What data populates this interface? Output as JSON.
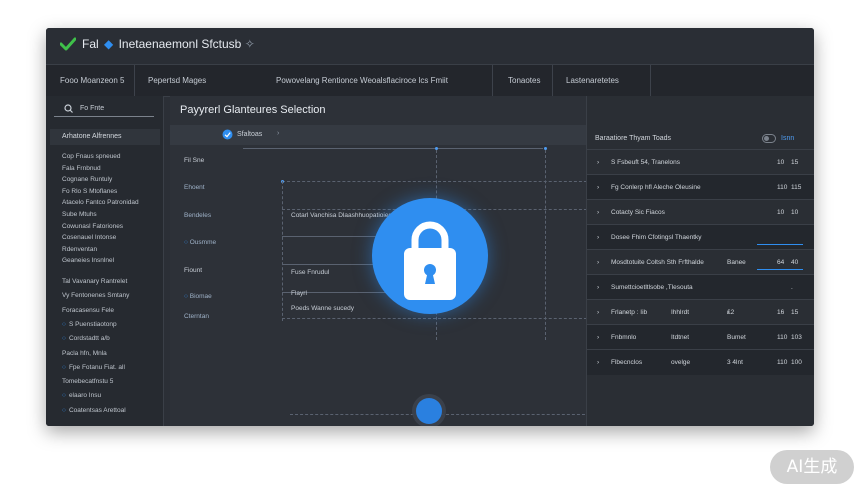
{
  "app": {
    "title_prefix": "Fal",
    "title_main": "Inetaenaemonl Sfctusb",
    "title_suffix": "✧"
  },
  "navbar": {
    "items": [
      "Fooo Moanzeon 5",
      "Pepertsd Mages",
      "Powovelang Rentionce Weoalsflaciroce lcs Fmiit",
      "Tonaotes",
      "Lastenaretetes"
    ]
  },
  "sidebar": {
    "search_text": "Fo Fnte",
    "header": "Arhatone Alfrennes",
    "group1": [
      "Cop Fnaus spneued",
      "Fala Frnbnud",
      "Cognane Runtuly",
      "Fo Rlo S Mtoflanes",
      "Atacelo Fantco Patronidad",
      "Sube Mtuhs",
      "Cowunasl Fatoriones",
      "Cosenauel Intonse",
      "Rdenventan",
      "Geaneies Insnlnel"
    ],
    "group2": [
      "Tal Vavanary Rantrelet",
      "Vy Fentonenes Smtany",
      "Foracasensu Fele",
      "S Puenstiaotonp",
      "Cordstadtt a/b",
      "Pacla hfn, Mnla",
      "Fpe Fotanu Fiat. all",
      "Tomebecatfnstu 5",
      "elaaro Insu",
      "Coatentsas Arettoal"
    ],
    "group2_dots": [
      false,
      false,
      false,
      true,
      true,
      false,
      true,
      false,
      true,
      true
    ]
  },
  "main": {
    "page_title": "Payyrerl Glanteures Selection",
    "toolbar_label": "Sfaltoas",
    "left_labels": [
      "Fil Sne",
      "Ehoent",
      "Bendeles",
      "Ousmme",
      "Fiount",
      "Biomae",
      "Cterntan"
    ],
    "mid_labels": [
      "Cotarl Vanchisa Dlaashhuopatioies",
      "Fuse Fnrudul",
      "Flayrl",
      "Poeds Wanne sucedy"
    ]
  },
  "rpanel": {
    "header": "Baraatiore Thyam Toads",
    "header_right": "Isnn",
    "rows": [
      {
        "c1": "S Fsbeuft 54, Tranelons",
        "c2": "",
        "c3": "",
        "c4": "10",
        "c5": "15"
      },
      {
        "c1": "Fg Conlerp hfl Aleche Oleusine",
        "c2": "",
        "c3": "",
        "c4": "110",
        "c5": "115"
      },
      {
        "c1": "Cotacty Sic Fiacos",
        "c2": "",
        "c3": "",
        "c4": "10",
        "c5": "10"
      },
      {
        "c1": "Dosee Fhim Cfotingsl Thaentky",
        "c2": "",
        "c3": "",
        "c4": "",
        "c5": ""
      },
      {
        "c1": "Mosdtotuite Coltsh Sth Frfthalde",
        "c2": "",
        "c3": "Banee",
        "c4": "64",
        "c5": "40"
      },
      {
        "c1": "Sumettcioetltlsobe ,Tlesouta",
        "c2": "",
        "c3": "",
        "c4": "",
        "c5": "."
      },
      {
        "c1": "Frlanetp : Iib",
        "c2": "Ihhlrdt",
        "c3": "₤2",
        "c4": "16",
        "c5": "15"
      },
      {
        "c1": "Fnbmnlo",
        "c2": "Itdtnet",
        "c3": "Bumet",
        "c4": "110",
        "c5": "103"
      },
      {
        "c1": "Flbecnclos",
        "c2": "ovelge",
        "c3": "3 4lnt",
        "c4": "110",
        "c5": "100"
      }
    ]
  },
  "colors": {
    "accent": "#2f8ef0",
    "window_bg": "#2b2f36",
    "check": "#3fc14a"
  },
  "watermark": "AI生成"
}
